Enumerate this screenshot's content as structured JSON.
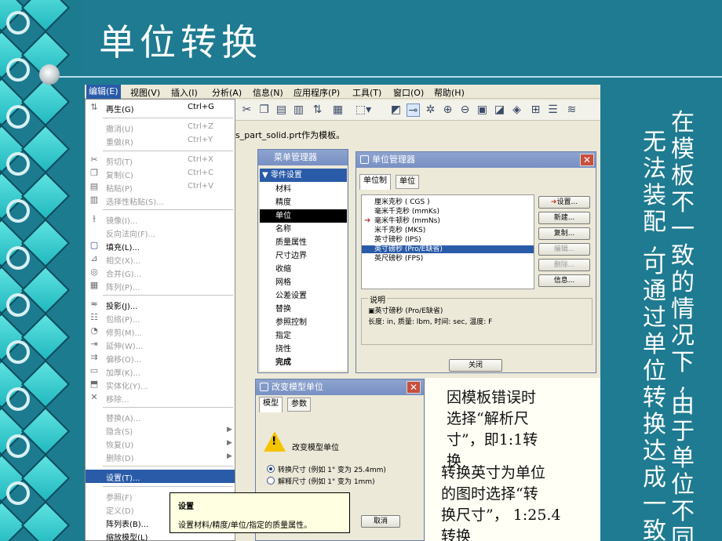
{
  "slide": {
    "title": "单位转换",
    "side_col1": [
      "在",
      "模",
      "板",
      "不",
      "一",
      "致",
      "的",
      "情",
      "况",
      "下",
      ",",
      "由",
      "于",
      "单",
      "位",
      "不",
      "同"
    ],
    "side_col2": [
      "无",
      "法",
      "装",
      "配",
      ",",
      "可",
      "通",
      "过",
      "单",
      "位",
      "转",
      "换",
      "达",
      "成",
      "一",
      "致",
      "。"
    ],
    "callout_lines": [
      "因模板错误时",
      "选择“解析尺",
      "寸”，即1:1转",
      "换",
      "转换英寸为单位",
      "的图时选择“转",
      "换尺寸”， 1:25.4",
      "转换"
    ]
  },
  "menubar": [
    "编辑(E)",
    "视图(V)",
    "插入(I)",
    "分析(A)",
    "信息(N)",
    "应用程序(P)",
    "工具(T)",
    "窗口(O)",
    "帮助(H)"
  ],
  "status_text": "s_part_solid.prt作为模板。",
  "edit_menu": [
    {
      "label": "再生(G)",
      "shortcut": "Ctrl+G",
      "icon": "regenerate-icon"
    },
    {
      "label": "撤消(U)",
      "shortcut": "Ctrl+Z",
      "icon": ""
    },
    {
      "label": "重做(R)",
      "shortcut": "Ctrl+Y",
      "icon": ""
    },
    {
      "label": "剪切(T)",
      "shortcut": "Ctrl+X",
      "icon": "scissors-icon"
    },
    {
      "label": "复制(C)",
      "shortcut": "Ctrl+C",
      "icon": "copy-icon"
    },
    {
      "label": "粘贴(P)",
      "shortcut": "Ctrl+V",
      "icon": "paste-icon"
    },
    {
      "label": "选择性粘贴(S)...",
      "shortcut": "",
      "icon": "paste-special-icon"
    },
    {
      "label": "镜像(I)...",
      "shortcut": "",
      "icon": "mirror-icon"
    },
    {
      "label": "反向法向(F)...",
      "shortcut": "",
      "icon": ""
    },
    {
      "label": "填充(L)...",
      "shortcut": "",
      "icon": "fill-icon"
    },
    {
      "label": "相交(X)...",
      "shortcut": "",
      "icon": "intersect-icon"
    },
    {
      "label": "合并(G)...",
      "shortcut": "",
      "icon": "merge-icon"
    },
    {
      "label": "阵列(P)...",
      "shortcut": "",
      "icon": "pattern-icon"
    },
    {
      "label": "投影(J)...",
      "shortcut": "",
      "icon": "project-icon"
    },
    {
      "label": "包络(P)...",
      "shortcut": "",
      "icon": "wrap-icon"
    },
    {
      "label": "修剪(M)...",
      "shortcut": "",
      "icon": "trim-icon"
    },
    {
      "label": "延伸(W)...",
      "shortcut": "",
      "icon": "extend-icon"
    },
    {
      "label": "偏移(O)...",
      "shortcut": "",
      "icon": "offset-icon"
    },
    {
      "label": "加厚(K)...",
      "shortcut": "",
      "icon": "thicken-icon"
    },
    {
      "label": "实体化(Y)...",
      "shortcut": "",
      "icon": "solidify-icon"
    },
    {
      "label": "移除...",
      "shortcut": "",
      "icon": "remove-icon"
    },
    {
      "label": "替换(A)...",
      "shortcut": "",
      "icon": ""
    },
    {
      "label": "隐含(S)",
      "shortcut": "",
      "icon": ""
    },
    {
      "label": "恢复(U)",
      "shortcut": "",
      "icon": ""
    },
    {
      "label": "删除(D)",
      "shortcut": "",
      "icon": ""
    },
    {
      "label": "设置(T)...",
      "shortcut": "",
      "icon": ""
    },
    {
      "label": "参照(F)",
      "shortcut": "",
      "icon": ""
    },
    {
      "label": "定义(D)",
      "shortcut": "",
      "icon": ""
    },
    {
      "label": "阵列表(B)...",
      "shortcut": "",
      "icon": ""
    },
    {
      "label": "缩放模型(L)",
      "shortcut": "",
      "icon": ""
    }
  ],
  "tooltip": {
    "title": "设置",
    "text": "设置材料/精度/单位/指定的质量属性。"
  },
  "menu_manager": {
    "title": "菜单管理器",
    "header": "零件设置",
    "items": [
      "材料",
      "精度",
      "单位",
      "名称",
      "质量属性",
      "尺寸边界",
      "收缩",
      "网格",
      "公差设置",
      "替换",
      "参照控制",
      "指定",
      "挠性",
      "完成"
    ],
    "selected": "单位"
  },
  "unit_manager": {
    "title": "单位管理器",
    "tabs": [
      "单位制",
      "单位"
    ],
    "units": [
      "厘米克秒 ( CGS )",
      "毫米千克秒 (mmKs)",
      "毫米牛顿秒 (mmNs)",
      "米千克秒 (MKS)",
      "英寸磅秒 (IPS)",
      "英寸磅秒 (Pro/E缺省)",
      "英尺磅秒 (FPS)"
    ],
    "selected_index": 5,
    "marked_index": 2,
    "buttons": [
      "设置...",
      "新建...",
      "复制...",
      "编辑...",
      "删除...",
      "信息..."
    ],
    "desc_label": "说明",
    "desc_name": "英寸磅秒 (Pro/E缺省)",
    "desc_detail": "长度: in, 质量: lbm, 时间: sec, 温度: F",
    "close": "关闭"
  },
  "change_units": {
    "title": "改变模型单位",
    "tabs": [
      "模型",
      "参数"
    ],
    "heading": "改变模型单位",
    "options": [
      "转换尺寸 (例如 1\" 变为 25.4mm)",
      "解释尺寸 (例如 1\" 变为 1mm)"
    ],
    "selected_index": 0,
    "cancel": "取消"
  }
}
